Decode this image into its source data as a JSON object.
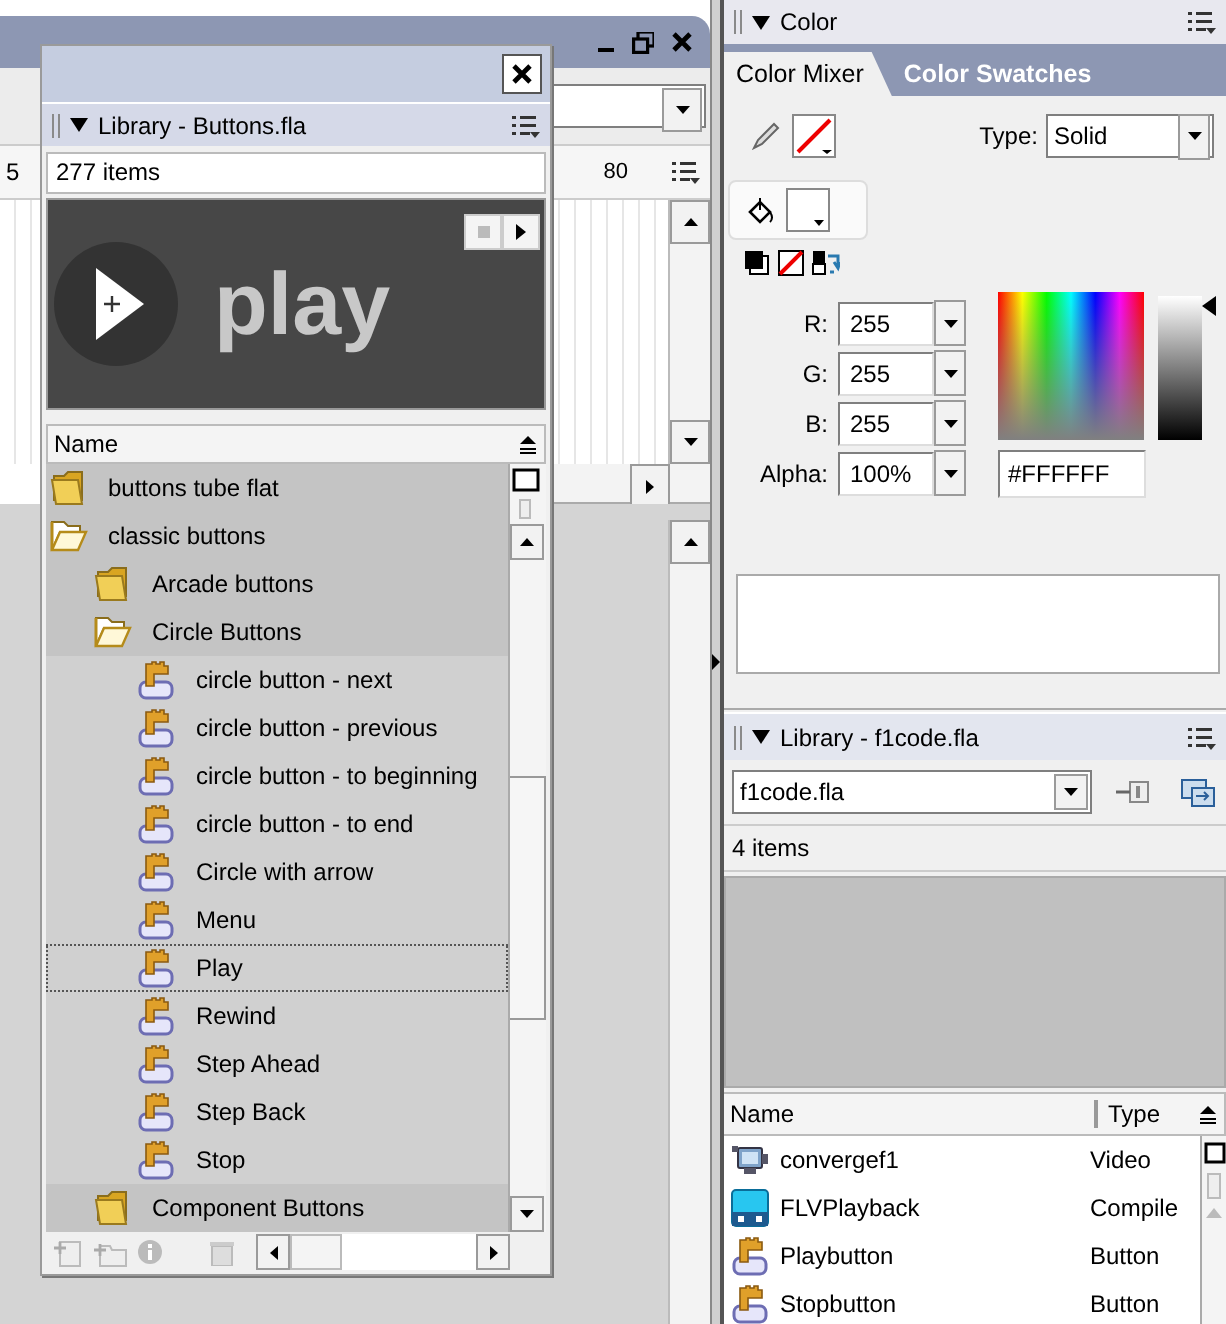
{
  "timeline": {
    "frame_numbers": [
      "5",
      "80"
    ]
  },
  "buttons_library": {
    "title": "Library - Buttons.fla",
    "item_count": "277 items",
    "preview_label": "play",
    "column": "Name",
    "items": [
      {
        "name": "buttons tube flat",
        "kind": "folder",
        "expanded": false,
        "selected": false
      },
      {
        "name": "classic buttons",
        "kind": "folder",
        "expanded": true,
        "selected": false,
        "children": [
          {
            "name": "Arcade buttons",
            "kind": "folder",
            "expanded": false,
            "selected": false
          },
          {
            "name": "Circle Buttons",
            "kind": "folder",
            "expanded": true,
            "selected": false,
            "children": [
              {
                "name": "circle button - next",
                "kind": "button",
                "selected": false
              },
              {
                "name": "circle button - previous",
                "kind": "button",
                "selected": false
              },
              {
                "name": "circle button - to beginning",
                "kind": "button",
                "selected": false
              },
              {
                "name": "circle button - to end",
                "kind": "button",
                "selected": false
              },
              {
                "name": "Circle with arrow",
                "kind": "button",
                "selected": false
              },
              {
                "name": "Menu",
                "kind": "button",
                "selected": false
              },
              {
                "name": "Play",
                "kind": "button",
                "selected": true
              },
              {
                "name": "Rewind",
                "kind": "button",
                "selected": false
              },
              {
                "name": "Step Ahead",
                "kind": "button",
                "selected": false
              },
              {
                "name": "Step Back",
                "kind": "button",
                "selected": false
              },
              {
                "name": "Stop",
                "kind": "button",
                "selected": false
              }
            ]
          },
          {
            "name": "Component Buttons",
            "kind": "folder",
            "expanded": false,
            "selected": false
          }
        ]
      }
    ]
  },
  "color_panel": {
    "title": "Color",
    "tabs": [
      {
        "label": "Color Mixer",
        "selected": true
      },
      {
        "label": "Color Swatches",
        "selected": false
      }
    ],
    "type_label": "Type:",
    "type_value": "Solid",
    "channels": [
      {
        "label": "R:",
        "value": "255"
      },
      {
        "label": "G:",
        "value": "255"
      },
      {
        "label": "B:",
        "value": "255"
      },
      {
        "label": "Alpha:",
        "value": "100%"
      }
    ],
    "hex": "#FFFFFF"
  },
  "file_library": {
    "title": "Library - f1code.fla",
    "library_select": "f1code.fla",
    "item_count": "4 items",
    "columns": [
      "Name",
      "Type"
    ],
    "rows": [
      {
        "name": "convergef1",
        "type": "Video",
        "kind": "video"
      },
      {
        "name": "FLVPlayback",
        "type": "Compile",
        "kind": "component"
      },
      {
        "name": "Playbutton",
        "type": "Button",
        "kind": "button"
      },
      {
        "name": "Stopbutton",
        "type": "Button",
        "kind": "button"
      }
    ]
  }
}
